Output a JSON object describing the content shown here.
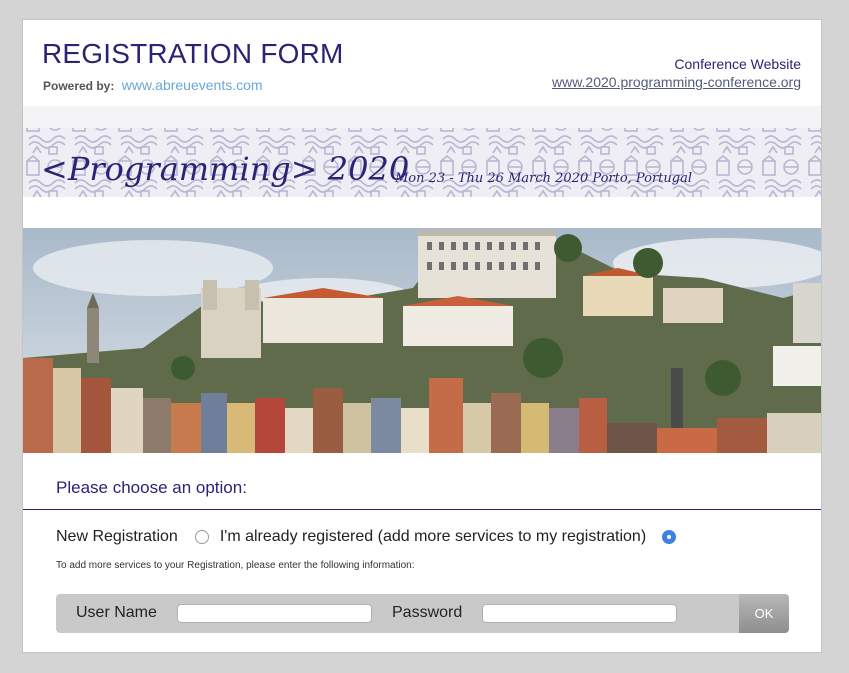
{
  "header": {
    "title": "REGISTRATION FORM",
    "powered_label": "Powered by:",
    "powered_link": "www.abreuevents.com",
    "conference_label": "Conference Website",
    "conference_link": "www.2020.programming-conference.org"
  },
  "banner": {
    "title": "<Programming> 2020",
    "dates": "Mon 23 - Thu 26 March 2020 Porto, Portugal"
  },
  "form": {
    "section_heading": "Please choose an option:",
    "option_new_label": "New Registration",
    "option_new_checked": false,
    "option_existing_label": "I'm already registered (add more services to my registration)",
    "option_existing_checked": true,
    "hint": "To add more services to your Registration, please enter the following information:",
    "username_label": "User Name",
    "username_value": "",
    "password_label": "Password",
    "password_value": "",
    "ok_label": "OK"
  },
  "colors": {
    "brand": "#2b2475",
    "link": "#6aa6d6",
    "radio_checked": "#3d82e0"
  }
}
